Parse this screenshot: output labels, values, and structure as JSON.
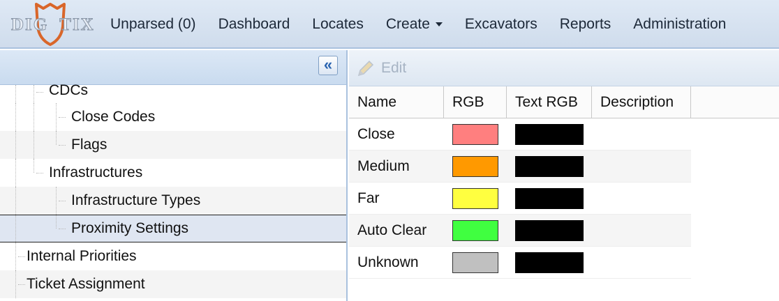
{
  "app": {
    "logo_text": "DIG  TIX",
    "logo_shield_color": "#d9662a"
  },
  "nav": {
    "items": [
      {
        "label": "Unparsed (0)"
      },
      {
        "label": "Dashboard"
      },
      {
        "label": "Locates"
      },
      {
        "label": "Create",
        "has_dropdown": true
      },
      {
        "label": "Excavators"
      },
      {
        "label": "Reports"
      },
      {
        "label": "Administration"
      }
    ]
  },
  "left_panel": {
    "collapse_icon": "double-chevron-left-icon",
    "collapse_glyph": "«",
    "tree": [
      {
        "label": "CDCs"
      },
      {
        "label": "Close Codes"
      },
      {
        "label": "Flags"
      },
      {
        "label": "Infrastructures"
      },
      {
        "label": "Infrastructure Types"
      },
      {
        "label": "Proximity Settings",
        "selected": true
      },
      {
        "label": "Internal Priorities"
      },
      {
        "label": "Ticket Assignment"
      }
    ]
  },
  "right_panel": {
    "toolbar": {
      "edit_label": "Edit",
      "edit_icon": "pencil-icon",
      "edit_enabled": false
    },
    "columns": [
      "Name",
      "RGB",
      "Text RGB",
      "Description"
    ],
    "rows": [
      {
        "name": "Close",
        "rgb": "#ff7f7f",
        "text_rgb": "#000000",
        "description": ""
      },
      {
        "name": "Medium",
        "rgb": "#ff9900",
        "text_rgb": "#000000",
        "description": ""
      },
      {
        "name": "Far",
        "rgb": "#ffff40",
        "text_rgb": "#000000",
        "description": ""
      },
      {
        "name": "Auto Clear",
        "rgb": "#40ff40",
        "text_rgb": "#000000",
        "description": ""
      },
      {
        "name": "Unknown",
        "rgb": "#c0c0c0",
        "text_rgb": "#000000",
        "description": ""
      }
    ]
  }
}
